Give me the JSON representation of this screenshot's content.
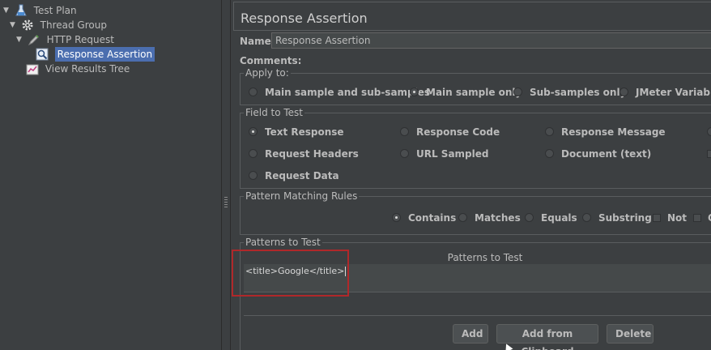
{
  "tree": {
    "items": [
      {
        "label": "Test Plan",
        "icon": "flask-icon"
      },
      {
        "label": "Thread Group",
        "icon": "gear-icon"
      },
      {
        "label": "HTTP Request",
        "icon": "pen-icon"
      },
      {
        "label": "Response Assertion",
        "icon": "magnifier-icon",
        "selected": true
      },
      {
        "label": "View Results Tree",
        "icon": "chart-icon"
      }
    ]
  },
  "panel": {
    "title": "Response Assertion",
    "name_label": "Name:",
    "name_value": "Response Assertion",
    "comments_label": "Comments:"
  },
  "apply_to": {
    "title": "Apply to:",
    "options": [
      {
        "label": "Main sample and sub-samples",
        "selected": false
      },
      {
        "label": "Main sample only",
        "selected": true
      },
      {
        "label": "Sub-samples only",
        "selected": false
      },
      {
        "label": "JMeter Variable N",
        "selected": false
      }
    ]
  },
  "field_to_test": {
    "title": "Field to Test",
    "options": [
      {
        "label": "Text Response",
        "selected": true
      },
      {
        "label": "Response Code",
        "selected": false
      },
      {
        "label": "Response Message",
        "selected": false
      },
      {
        "label": "Request Headers",
        "selected": false
      },
      {
        "label": "URL Sampled",
        "selected": false
      },
      {
        "label": "Document (text)",
        "selected": false
      },
      {
        "label": "Request Data",
        "selected": false
      }
    ]
  },
  "pattern_matching": {
    "title": "Pattern Matching Rules",
    "options": [
      {
        "label": "Contains",
        "selected": true
      },
      {
        "label": "Matches",
        "selected": false
      },
      {
        "label": "Equals",
        "selected": false
      },
      {
        "label": "Substring",
        "selected": false
      }
    ],
    "not_label": "Not",
    "or_label": "O"
  },
  "patterns": {
    "title": "Patterns to Test",
    "column_header": "Patterns to Test",
    "rows": [
      "<title>Google</title>"
    ]
  },
  "buttons": {
    "add": "Add",
    "add_from_clipboard": "Add from Clipboard",
    "delete": "Delete"
  },
  "colors": {
    "background": "#3c3f41",
    "selection": "#4b6eaf",
    "highlight": "#b0282a"
  }
}
